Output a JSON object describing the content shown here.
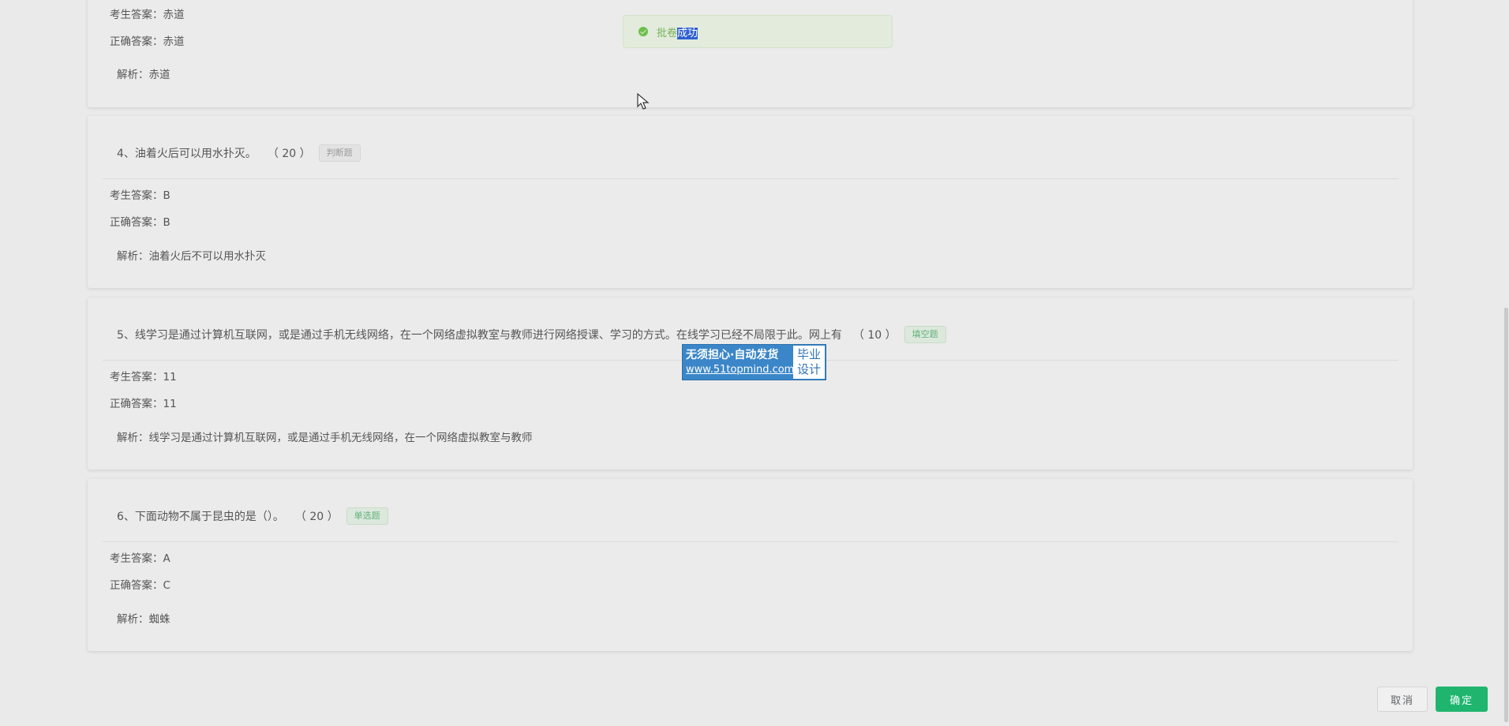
{
  "question3": {
    "student_answer": "考生答案：赤道",
    "correct_answer": "正确答案：赤道",
    "analysis": "解析：赤道"
  },
  "question4": {
    "title": "4、油着火后可以用水扑灭。",
    "score": "（ 20 ）",
    "tag": "判断题",
    "student_answer": "考生答案：B",
    "correct_answer": "正确答案：B",
    "analysis": "解析：油着火后不可以用水扑灭"
  },
  "question5": {
    "title": "5、线学习是通过计算机互联网，或是通过手机无线网络，在一个网络虚拟教室与教师进行网络授课、学习的方式。在线学习已经不局限于此。网上有",
    "score": "（ 10 ）",
    "tag": "填空题",
    "student_answer": "考生答案：11",
    "correct_answer": "正确答案：11",
    "analysis": "解析：线学习是通过计算机互联网，或是通过手机无线网络，在一个网络虚拟教室与教师"
  },
  "question6": {
    "title": "6、下面动物不属于昆虫的是（）。",
    "score": "（ 20 ）",
    "tag": "单选题",
    "student_answer": "考生答案：A",
    "correct_answer": "正确答案：C",
    "analysis": "解析：蜘蛛"
  },
  "toast": {
    "text_plain": "批卷",
    "text_selected": "成功"
  },
  "watermark": {
    "line1": "无须担心·自动发货",
    "line2": "www.51topmind.com",
    "right_line1": "毕业",
    "right_line2": "设计"
  },
  "buttons": {
    "cancel": "取消",
    "confirm": "确定"
  },
  "colors": {
    "confirm": "#1fb56f",
    "success": "#6cbf4a"
  }
}
